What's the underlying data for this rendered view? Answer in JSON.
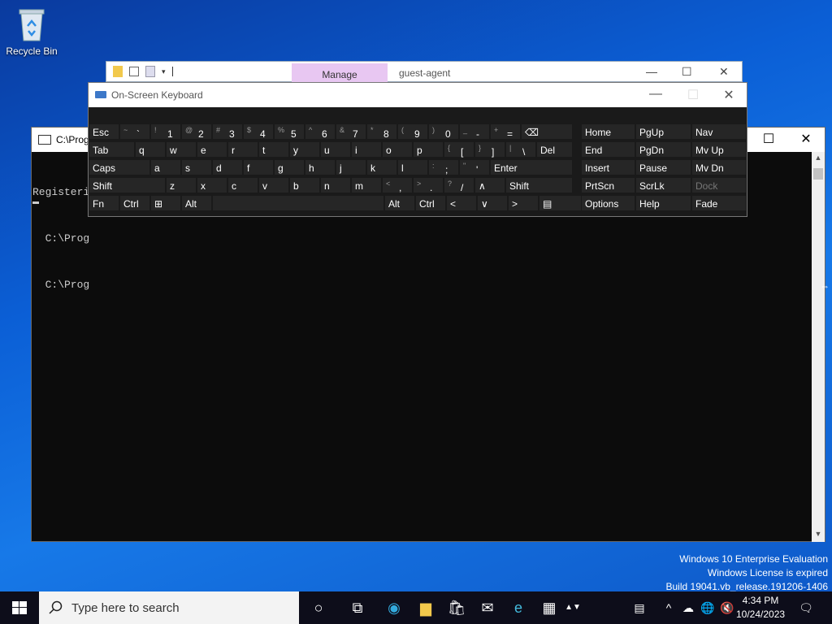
{
  "desktop": {
    "recycle_bin_label": "Recycle Bin"
  },
  "explorer": {
    "ribbon_tab": "Manage",
    "title": "guest-agent"
  },
  "console": {
    "title": "C:\\Prog",
    "lines": [
      "Registeri",
      "  C:\\Prog",
      "  C:\\Prog"
    ]
  },
  "osk": {
    "title": "On-Screen Keyboard",
    "row1": [
      {
        "p": "Esc"
      },
      {
        "s": "~",
        "p": "`"
      },
      {
        "s": "!",
        "p": "1"
      },
      {
        "s": "@",
        "p": "2"
      },
      {
        "s": "#",
        "p": "3"
      },
      {
        "s": "$",
        "p": "4"
      },
      {
        "s": "%",
        "p": "5"
      },
      {
        "s": "^",
        "p": "6"
      },
      {
        "s": "&",
        "p": "7"
      },
      {
        "s": "*",
        "p": "8"
      },
      {
        "s": "(",
        "p": "9"
      },
      {
        "s": ")",
        "p": "0"
      },
      {
        "s": "_",
        "p": "-"
      },
      {
        "s": "+",
        "p": "="
      },
      {
        "p": "⌫"
      }
    ],
    "row2": [
      {
        "p": "Tab"
      },
      {
        "p": "q"
      },
      {
        "p": "w"
      },
      {
        "p": "e"
      },
      {
        "p": "r"
      },
      {
        "p": "t"
      },
      {
        "p": "y"
      },
      {
        "p": "u"
      },
      {
        "p": "i"
      },
      {
        "p": "o"
      },
      {
        "p": "p"
      },
      {
        "s": "{",
        "p": "["
      },
      {
        "s": "}",
        "p": "]"
      },
      {
        "s": "|",
        "p": "\\"
      },
      {
        "p": "Del"
      }
    ],
    "row3": [
      {
        "p": "Caps"
      },
      {
        "p": "a"
      },
      {
        "p": "s"
      },
      {
        "p": "d"
      },
      {
        "p": "f"
      },
      {
        "p": "g"
      },
      {
        "p": "h"
      },
      {
        "p": "j"
      },
      {
        "p": "k"
      },
      {
        "p": "l"
      },
      {
        "s": ":",
        "p": ";"
      },
      {
        "s": "\"",
        "p": "'"
      },
      {
        "p": "Enter"
      }
    ],
    "row4": [
      {
        "p": "Shift"
      },
      {
        "p": "z"
      },
      {
        "p": "x"
      },
      {
        "p": "c"
      },
      {
        "p": "v"
      },
      {
        "p": "b"
      },
      {
        "p": "n"
      },
      {
        "p": "m"
      },
      {
        "s": "<",
        "p": ","
      },
      {
        "s": ">",
        "p": "."
      },
      {
        "s": "?",
        "p": "/"
      },
      {
        "p": "∧"
      },
      {
        "p": "Shift"
      }
    ],
    "row5": [
      {
        "p": "Fn"
      },
      {
        "p": "Ctrl"
      },
      {
        "p": "⊞"
      },
      {
        "p": "Alt"
      },
      {
        "p": ""
      },
      {
        "p": "Alt"
      },
      {
        "p": "Ctrl"
      },
      {
        "p": "<"
      },
      {
        "p": "∨"
      },
      {
        "p": ">"
      },
      {
        "p": "▤"
      }
    ],
    "nav": [
      [
        "Home",
        "PgUp",
        "Nav"
      ],
      [
        "End",
        "PgDn",
        "Mv Up"
      ],
      [
        "Insert",
        "Pause",
        "Mv Dn"
      ],
      [
        "PrtScn",
        "ScrLk",
        "Dock"
      ],
      [
        "Options",
        "Help",
        "Fade"
      ]
    ]
  },
  "watermark": [
    "Windows 10 Enterprise Evaluation",
    "Windows License is expired",
    "Build 19041.vb_release.191206-1406"
  ],
  "taskbar": {
    "search_placeholder": "Type here to search",
    "time": "4:34 PM",
    "date": "10/24/2023"
  }
}
